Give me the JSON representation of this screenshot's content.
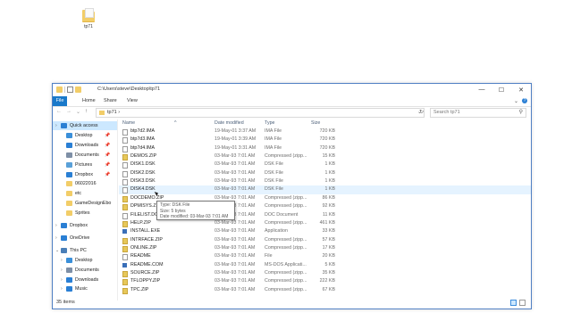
{
  "desktop": {
    "icon_label": "tp71"
  },
  "window": {
    "title_path": "C:\\Users\\steve\\Desktop\\tp71",
    "buttons": {
      "minimize": "—",
      "maximize": "☐",
      "close": "✕"
    }
  },
  "ribbon": {
    "tabs": [
      "File",
      "Home",
      "Share",
      "View"
    ],
    "expand_glyph": "⌄"
  },
  "address": {
    "back": "←",
    "forward": "→",
    "recent": "⌄",
    "up": "↑",
    "crumb": "tp71  ›",
    "dropdown": "⌄",
    "refresh": "↻",
    "search_placeholder": "Search tp71",
    "search_glyph": "⚲"
  },
  "navpane": {
    "items": [
      {
        "label": "Quick access",
        "selected": true,
        "icon": "star-icon",
        "color": "#2a7fd4",
        "chev": "›",
        "indent": 1
      },
      {
        "label": "Desktop",
        "icon": "desktop-icon",
        "color": "#3a8fd9",
        "pin": "📌",
        "indent": 2
      },
      {
        "label": "Downloads",
        "icon": "downloads-icon",
        "color": "#2a7fd4",
        "pin": "📌",
        "indent": 2
      },
      {
        "label": "Documents",
        "icon": "documents-icon",
        "color": "#7e8fa6",
        "pin": "📌",
        "indent": 2
      },
      {
        "label": "Pictures",
        "icon": "pictures-icon",
        "color": "#5aa0d8",
        "pin": "📌",
        "indent": 2
      },
      {
        "label": "Dropbox",
        "icon": "dropbox-icon",
        "color": "#2a7fd4",
        "pin": "📌",
        "indent": 2
      },
      {
        "label": "06022016",
        "icon": "folder-icon",
        "color": "#f2cd68",
        "indent": 2
      },
      {
        "label": "etc",
        "icon": "folder-icon",
        "color": "#f2cd68",
        "indent": 2
      },
      {
        "label": "GameDesignEbo",
        "icon": "folder-icon",
        "color": "#f2cd68",
        "indent": 2
      },
      {
        "label": "Sprites",
        "icon": "folder-icon",
        "color": "#f2cd68",
        "indent": 2
      },
      {
        "label": "Dropbox",
        "icon": "dropbox-icon",
        "color": "#2a7fd4",
        "chev": "›",
        "indent": 1,
        "gap": true
      },
      {
        "label": "OneDrive",
        "icon": "onedrive-icon",
        "color": "#2a7fd4",
        "chev": "›",
        "indent": 1,
        "gap": true
      },
      {
        "label": "This PC",
        "icon": "pc-icon",
        "color": "#4a7fb8",
        "chev": "⌄",
        "indent": 1,
        "gap": true
      },
      {
        "label": "Desktop",
        "icon": "desktop-icon",
        "color": "#3a8fd9",
        "chev": "›",
        "indent": 2
      },
      {
        "label": "Documents",
        "icon": "documents-icon",
        "color": "#7e8fa6",
        "chev": "›",
        "indent": 2
      },
      {
        "label": "Downloads",
        "icon": "downloads-icon",
        "color": "#2a7fd4",
        "chev": "›",
        "indent": 2
      },
      {
        "label": "Music",
        "icon": "music-icon",
        "color": "#2a7fd4",
        "chev": "›",
        "indent": 2
      }
    ]
  },
  "columns": {
    "name": "Name",
    "date": "Date modified",
    "type": "Type",
    "size": "Size",
    "sort_glyph": "^"
  },
  "files": [
    {
      "name": "btp7d2.IMA",
      "date": "19-May-01 3:37 AM",
      "type": "IMA File",
      "size": "720 KB",
      "kind": "doc"
    },
    {
      "name": "btp7d3.IMA",
      "date": "19-May-01 3:39 AM",
      "type": "IMA File",
      "size": "720 KB",
      "kind": "doc"
    },
    {
      "name": "btp7d4.IMA",
      "date": "19-May-01 3:31 AM",
      "type": "IMA File",
      "size": "720 KB",
      "kind": "doc"
    },
    {
      "name": "DEMOS.ZIP",
      "date": "03-Mar-93 7:01 AM",
      "type": "Compressed (zipp...",
      "size": "15 KB",
      "kind": "zip"
    },
    {
      "name": "DISK1.DSK",
      "date": "03-Mar-93 7:01 AM",
      "type": "DSK File",
      "size": "1 KB",
      "kind": "doc"
    },
    {
      "name": "DISK2.DSK",
      "date": "03-Mar-93 7:01 AM",
      "type": "DSK File",
      "size": "1 KB",
      "kind": "doc"
    },
    {
      "name": "DISK3.DSK",
      "date": "03-Mar-93 7:01 AM",
      "type": "DSK File",
      "size": "1 KB",
      "kind": "doc"
    },
    {
      "name": "DISK4.DSK",
      "date": "03-Mar-93 7:01 AM",
      "type": "DSK File",
      "size": "1 KB",
      "kind": "doc",
      "hover": true
    },
    {
      "name": "DOCDEMO.ZIP",
      "date": "03-Mar-93 7:01 AM",
      "type": "Compressed (zipp...",
      "size": "86 KB",
      "kind": "zip"
    },
    {
      "name": "DPMISYS.ZIP",
      "date": "03-Mar-93 7:01 AM",
      "type": "Compressed (zipp...",
      "size": "92 KB",
      "kind": "zip"
    },
    {
      "name": "FILELIST.DOC",
      "date": "03-Mar-93 7:01 AM",
      "type": "DOC Document",
      "size": "11 KB",
      "kind": "doc"
    },
    {
      "name": "HELP.ZIP",
      "date": "03-Mar-93 7:01 AM",
      "type": "Compressed (zipp...",
      "size": "461 KB",
      "kind": "zip"
    },
    {
      "name": "INSTALL.EXE",
      "date": "03-Mar-93 7:01 AM",
      "type": "Application",
      "size": "33 KB",
      "kind": "exe"
    },
    {
      "name": "INTRFACE.ZIP",
      "date": "03-Mar-93 7:01 AM",
      "type": "Compressed (zipp...",
      "size": "57 KB",
      "kind": "zip"
    },
    {
      "name": "ONLINE.ZIP",
      "date": "03-Mar-93 7:01 AM",
      "type": "Compressed (zipp...",
      "size": "17 KB",
      "kind": "zip"
    },
    {
      "name": "README",
      "date": "03-Mar-93 7:01 AM",
      "type": "File",
      "size": "20 KB",
      "kind": "doc"
    },
    {
      "name": "README.COM",
      "date": "03-Mar-93 7:01 AM",
      "type": "MS-DOS Applicati...",
      "size": "5 KB",
      "kind": "exe"
    },
    {
      "name": "SOURCE.ZIP",
      "date": "03-Mar-93 7:01 AM",
      "type": "Compressed (zipp...",
      "size": "35 KB",
      "kind": "zip"
    },
    {
      "name": "TFLOPPY.ZIP",
      "date": "03-Mar-93 7:01 AM",
      "type": "Compressed (zipp...",
      "size": "222 KB",
      "kind": "zip"
    },
    {
      "name": "TPC.ZIP",
      "date": "03-Mar-93 7:01 AM",
      "type": "Compressed (zipp...",
      "size": "67 KB",
      "kind": "zip"
    }
  ],
  "tooltip": {
    "line1": "Type: DSK File",
    "line2": "Size: 5 bytes",
    "line3": "Date modified: 03-Mar-93 7:01 AM"
  },
  "status": {
    "count": "35 items"
  }
}
